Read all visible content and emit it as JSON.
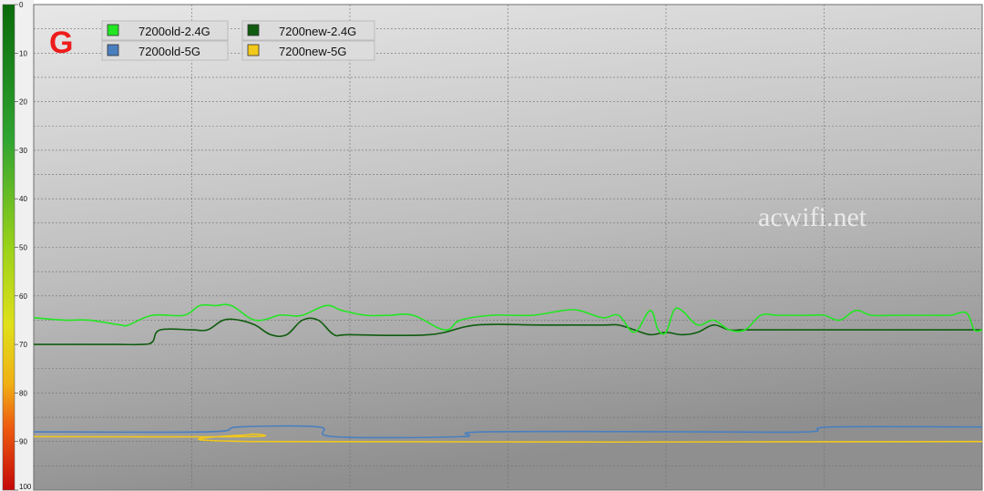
{
  "chart_data": {
    "type": "line",
    "corner_label": "G",
    "watermark": "acwifi.net",
    "y_ticks": [
      0,
      10,
      20,
      30,
      40,
      50,
      60,
      70,
      80,
      90,
      100
    ],
    "ylim": [
      0,
      100
    ],
    "y_inverted": true,
    "x_range": [
      0,
      600
    ],
    "grid": true,
    "legend_position": "top-left",
    "series": [
      {
        "name": "7200old-2.4G",
        "color": "#22e622",
        "stroke": 1.6,
        "x": [
          0,
          20,
          35,
          55,
          60,
          75,
          95,
          105,
          115,
          125,
          140,
          155,
          160,
          170,
          185,
          195,
          210,
          225,
          240,
          260,
          270,
          290,
          315,
          335,
          345,
          360,
          370,
          380,
          390,
          395,
          400,
          405,
          410,
          420,
          430,
          440,
          450,
          460,
          470,
          480,
          490,
          500,
          510,
          520,
          530,
          545,
          560,
          570,
          580,
          590,
          595,
          600
        ],
        "values": [
          64.5,
          65,
          65,
          66,
          66,
          64,
          64,
          62,
          62,
          62,
          65,
          64,
          64,
          64,
          62,
          63,
          64,
          64,
          64,
          67,
          65,
          64,
          64,
          63,
          63,
          64.5,
          64,
          67.5,
          63,
          67,
          67.5,
          63,
          63,
          66,
          65,
          67,
          67,
          64,
          64,
          64,
          64,
          64,
          65,
          63,
          64,
          64,
          64,
          64,
          64,
          63.5,
          67,
          67
        ]
      },
      {
        "name": "7200new-2.4G",
        "color": "#0f5c0f",
        "stroke": 1.6,
        "x": [
          0,
          50,
          68,
          75,
          80,
          100,
          110,
          120,
          130,
          140,
          150,
          160,
          170,
          180,
          190,
          200,
          250,
          280,
          320,
          360,
          370,
          380,
          390,
          400,
          410,
          420,
          430,
          440,
          450,
          460,
          600
        ],
        "values": [
          70,
          70,
          70,
          69.5,
          67,
          67,
          67,
          65,
          65,
          66,
          68,
          68,
          65,
          65,
          68,
          68,
          68,
          66,
          66,
          66,
          66,
          67,
          68,
          67.5,
          68,
          67.5,
          66,
          67,
          67,
          67,
          67
        ]
      },
      {
        "name": "7200old-5G",
        "color": "#4a7fbf",
        "stroke": 1.6,
        "x": [
          0,
          110,
          130,
          180,
          190,
          270,
          285,
          420,
          490,
          505,
          600
        ],
        "values": [
          88,
          88,
          87,
          87,
          89,
          89,
          88,
          88,
          88,
          87,
          87
        ]
      },
      {
        "name": "7200new-5G",
        "color": "#f2c81a",
        "stroke": 1.6,
        "x": [
          0,
          135,
          138,
          142,
          600
        ],
        "values": [
          89,
          89,
          88.5,
          90,
          90
        ]
      }
    ]
  }
}
